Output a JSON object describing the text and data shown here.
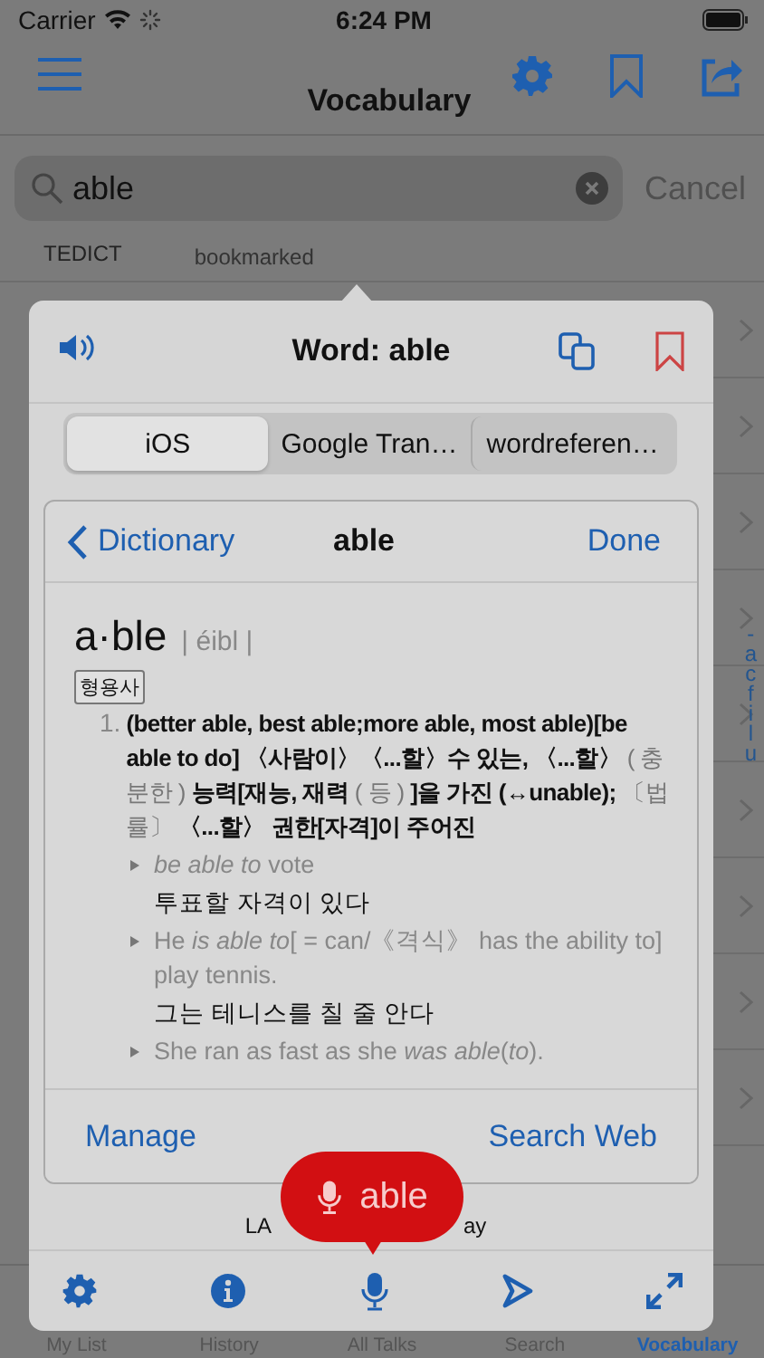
{
  "status_bar": {
    "carrier": "Carrier",
    "time": "6:24 PM"
  },
  "nav": {
    "title": "Vocabulary"
  },
  "search": {
    "value": "able",
    "cancel": "Cancel"
  },
  "list": {
    "rows": [
      {
        "title": "TEDICT",
        "subtitle": "bookmarked"
      }
    ],
    "index_letters": [
      "-",
      "a",
      "c",
      "f",
      "i",
      "l",
      "u"
    ]
  },
  "popover": {
    "title": "Word: able",
    "segments": [
      {
        "label": "iOS",
        "selected": true
      },
      {
        "label": "Google Tran…",
        "selected": false
      },
      {
        "label": "wordreferen…",
        "selected": false
      }
    ],
    "dictionary": {
      "back": "Dictionary",
      "title": "able",
      "done": "Done",
      "headword": "a·ble",
      "pronunciation": "| éibl |",
      "part_of_speech": "형용사",
      "sense_number": "1.",
      "definition": "**(better able, best able;more able, most able)[be able to do] 〈사람이〉〈...할〉수 있는, 〈...할〉** ( 충분한 ) **능력[재능, 재력** ( 등 ) **]을 가진 (↔unable);** 〔법률〕 **〈...할〉 권한[자격]이 주어진**",
      "examples": [
        {
          "kind": "example",
          "text": "*be able to* vote"
        },
        {
          "kind": "translation",
          "text": "투표할 자격이 있다"
        },
        {
          "kind": "example",
          "text": "He *is able to*[ = can/《격식》 has the ability to] play tennis."
        },
        {
          "kind": "translation",
          "text": "그는 테니스를 칠 줄 안다"
        },
        {
          "kind": "example",
          "text": "She ran as fast as she *was able*(*to*)."
        }
      ],
      "manage": "Manage",
      "search_web": "Search Web"
    },
    "footer_left": "LA",
    "footer_right": "ay",
    "speech_bubble": "able"
  },
  "tabs": [
    {
      "label": "My List",
      "selected": false
    },
    {
      "label": "History",
      "selected": false
    },
    {
      "label": "All Talks",
      "selected": false
    },
    {
      "label": "Search",
      "selected": false
    },
    {
      "label": "Vocabulary",
      "selected": true
    }
  ]
}
